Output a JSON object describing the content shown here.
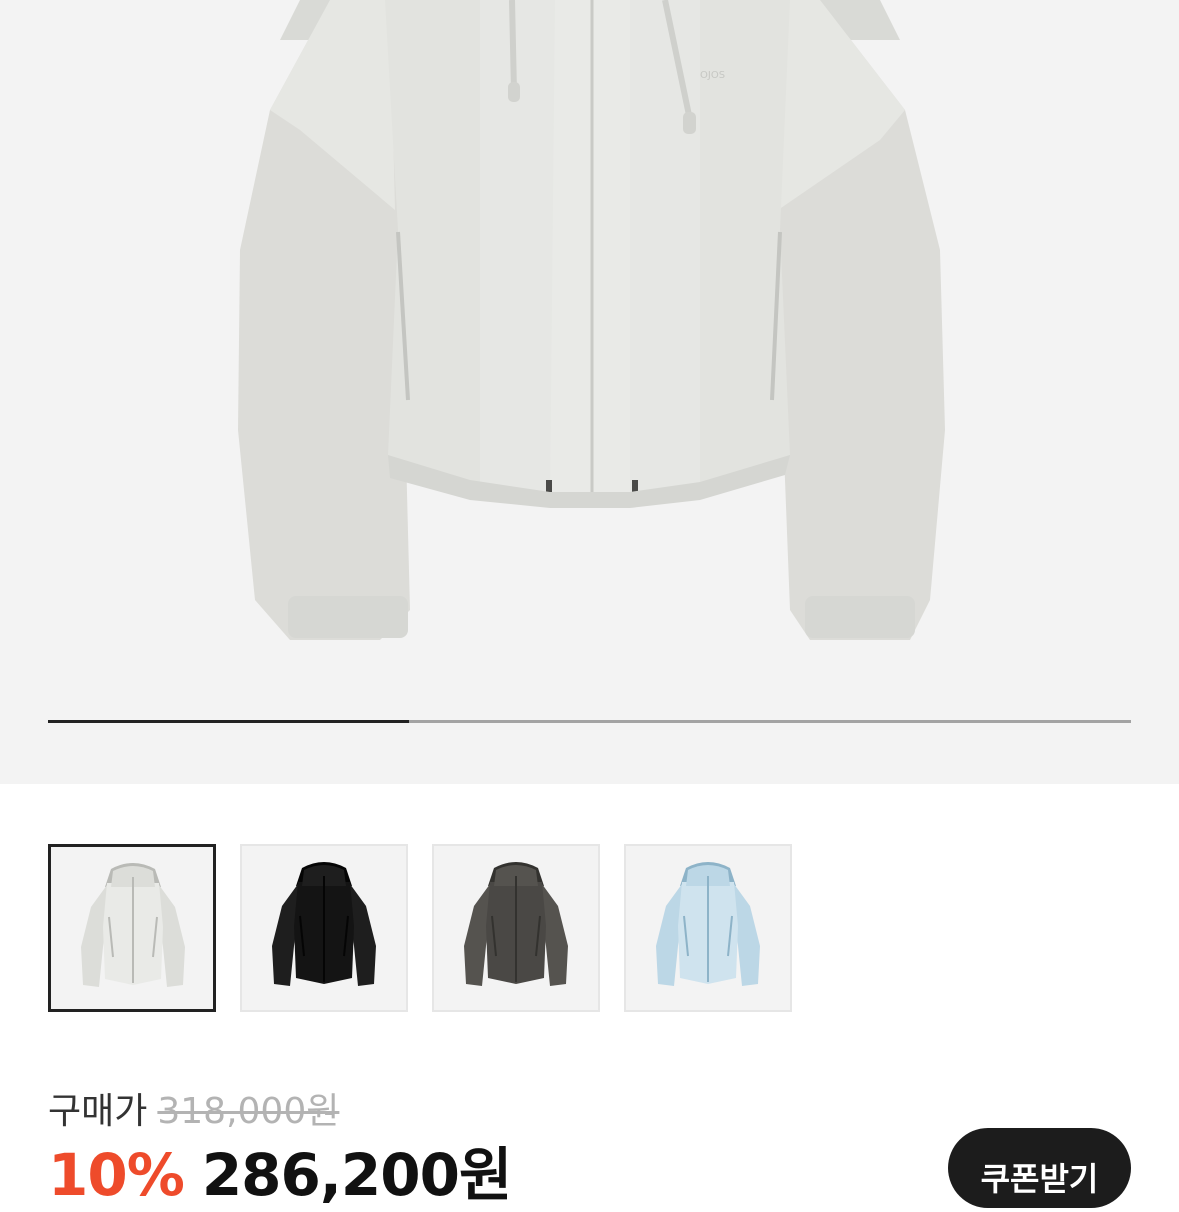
{
  "gallery": {
    "progress": 0.333,
    "selected_index": 0,
    "main_image": "jacket-light-gray-front",
    "thumbnails": [
      {
        "color_name": "light-gray",
        "body": "#dcddd9",
        "panel": "#e9eae7",
        "dark": "#b9bab6"
      },
      {
        "color_name": "black",
        "body": "#1e1e1e",
        "panel": "#141414",
        "dark": "#050505"
      },
      {
        "color_name": "charcoal",
        "body": "#55534f",
        "panel": "#4a4845",
        "dark": "#33322f"
      },
      {
        "color_name": "light-blue",
        "body": "#bcd7e6",
        "panel": "#cfe3ee",
        "dark": "#8db3c8"
      }
    ]
  },
  "price": {
    "label": "구매가",
    "original": "318,000원",
    "discount": "10%",
    "sale": "286,200원"
  },
  "coupon_button": {
    "label": "쿠폰받기"
  },
  "colors": {
    "discount_red": "#ee4b2b",
    "button_dark": "#1c1c1c"
  }
}
